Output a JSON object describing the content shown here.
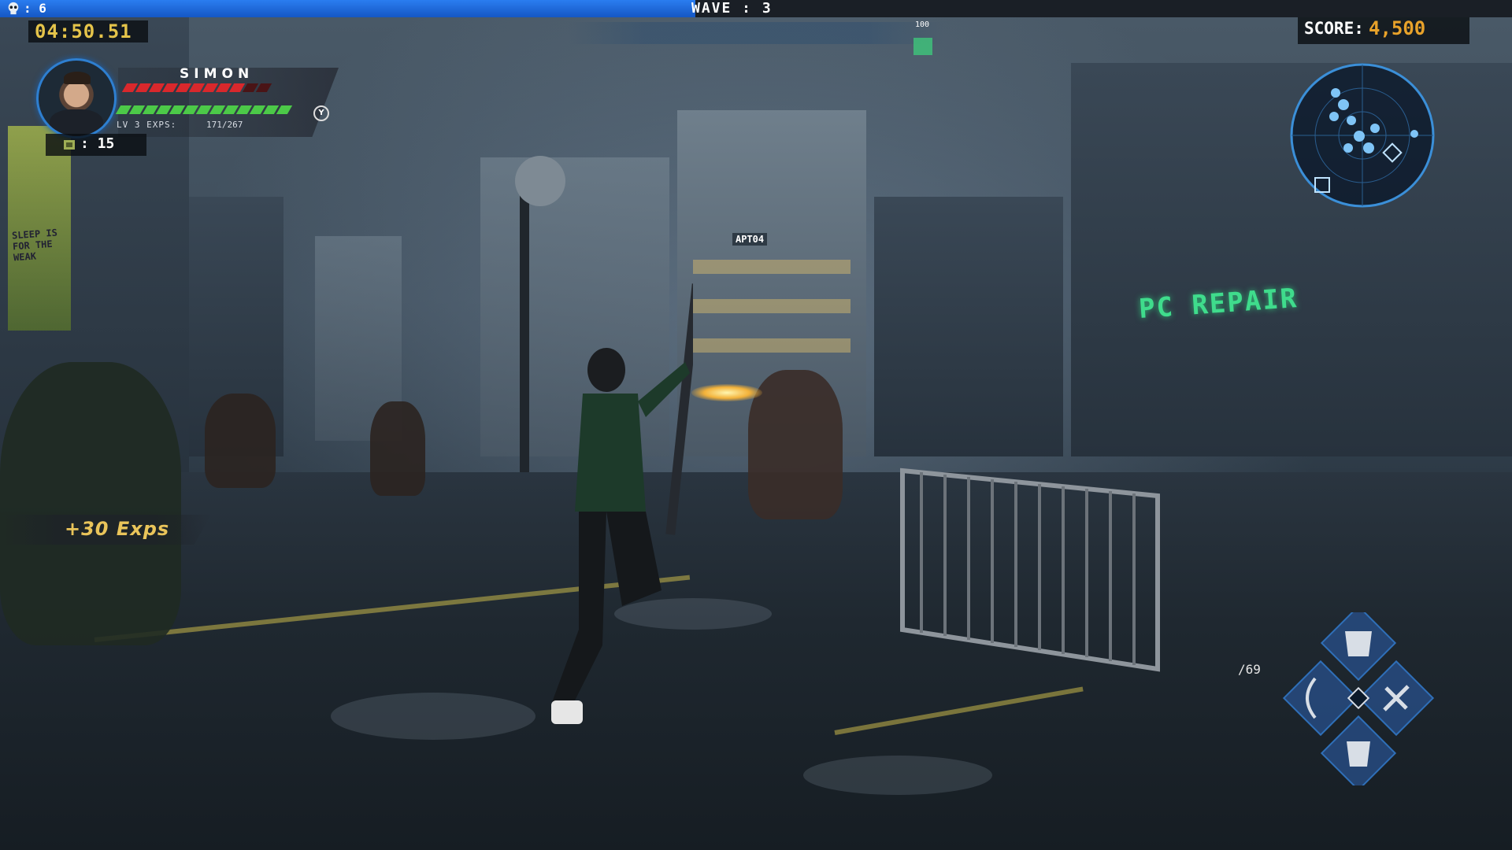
{
  "hud": {
    "kills": ": 6",
    "wave": "WAVE : 3",
    "wave_progress": 0.46,
    "timer": "04:50.51",
    "player": {
      "name": "SIMON",
      "level": "LV 3 EXPS:",
      "exp": "171/267",
      "health_segments": 11,
      "health_filled": 9,
      "stamina_segments": 13,
      "stamina_filled": 13
    },
    "ammo_count": ": 15",
    "boss_value": "100",
    "score_label": "SCORE:",
    "score_value": "4,500",
    "exp_popup": "+30 Exps",
    "ammo_reserve": "/69",
    "colors": {
      "wave_bar": "#1e6de0",
      "timer": "#e5c44a",
      "score": "#e8a22a",
      "health": "#d9282c",
      "stamina": "#4cc948",
      "minimap": "#3b8fd8"
    }
  },
  "scene": {
    "sign_1": "PC REPAIR",
    "sign_2": "APT04",
    "billboard": "SLEEP IS FOR THE WEAK"
  },
  "icons": {
    "kills": "skull-icon",
    "confirm": "y-button-icon",
    "ammo": "ammo-icon",
    "weapon_wheel": [
      "armor-icon",
      "sword-icon",
      "bow-icon",
      "boots-icon"
    ]
  }
}
